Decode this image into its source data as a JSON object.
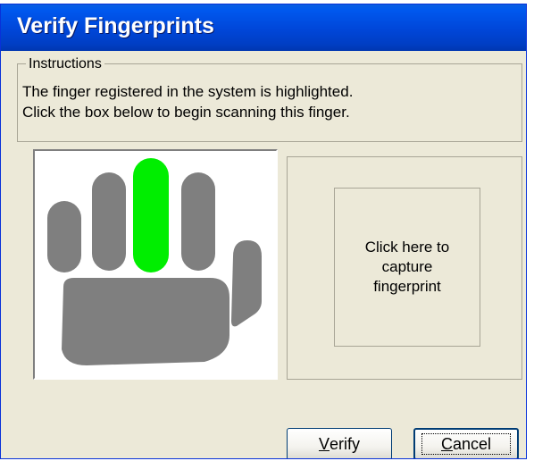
{
  "window": {
    "title": "Verify Fingerprints"
  },
  "instructions": {
    "legend": "Instructions",
    "line1": "The finger registered in the system is highlighted.",
    "line2": "Click the box below to begin scanning this finger."
  },
  "hand": {
    "highlighted_finger": "middle",
    "highlight_color": "#00ee00",
    "hand_color": "#7f7f7f"
  },
  "capture": {
    "text": "Click here to capture fingerprint"
  },
  "buttons": {
    "verify": {
      "mnemonic": "V",
      "rest": "erify"
    },
    "cancel": {
      "mnemonic": "C",
      "rest": "ancel"
    }
  }
}
